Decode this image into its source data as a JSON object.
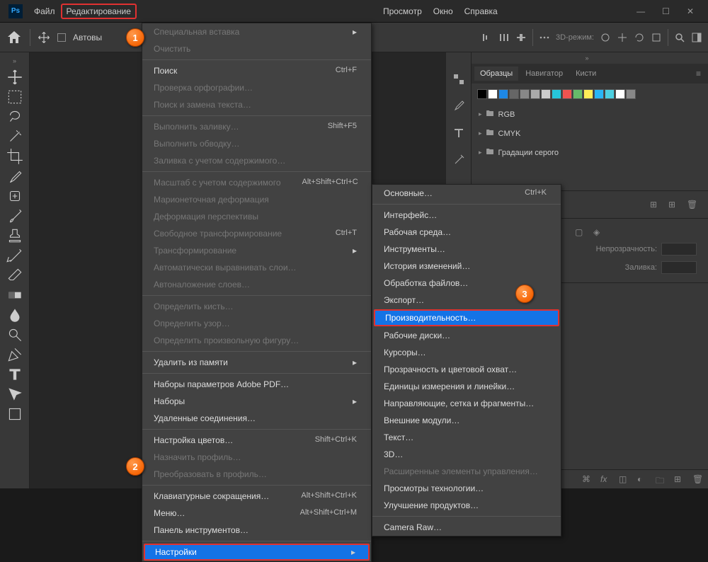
{
  "menubar": {
    "file": "Файл",
    "edit": "Редактирование",
    "view": "Просмотр",
    "window": "Окно",
    "help": "Справка"
  },
  "toolbar": {
    "autoselect": "Автовы",
    "mode3d": "3D-режим:"
  },
  "editMenu": {
    "pasteSpecial": "Специальная вставка",
    "clear": "Очистить",
    "search": "Поиск",
    "searchShortcut": "Ctrl+F",
    "spellCheck": "Проверка орфографии…",
    "findReplace": "Поиск и замена текста…",
    "fill": "Выполнить заливку…",
    "fillShortcut": "Shift+F5",
    "stroke": "Выполнить обводку…",
    "contentAwareFill": "Заливка с учетом содержимого…",
    "contentAwareScale": "Масштаб с учетом содержимого",
    "contentAwareScaleShortcut": "Alt+Shift+Ctrl+C",
    "puppetWarp": "Марионеточная деформация",
    "perspectiveWarp": "Деформация перспективы",
    "freeTransform": "Свободное трансформирование",
    "freeTransformShortcut": "Ctrl+T",
    "transform": "Трансформирование",
    "autoAlign": "Автоматически выравнивать слои…",
    "autoBlend": "Автоналожение слоев…",
    "defineBrush": "Определить кисть…",
    "definePattern": "Определить узор…",
    "defineShape": "Определить произвольную фигуру…",
    "purge": "Удалить из памяти",
    "pdfPresets": "Наборы параметров Adobe PDF…",
    "presets": "Наборы",
    "remoteConnections": "Удаленные соединения…",
    "colorSettings": "Настройка цветов…",
    "colorSettingsShortcut": "Shift+Ctrl+K",
    "assignProfile": "Назначить профиль…",
    "convertProfile": "Преобразовать в профиль…",
    "keyboardShortcuts": "Клавиатурные сокращения…",
    "keyboardShortcutsShortcut": "Alt+Shift+Ctrl+K",
    "menus": "Меню…",
    "menusShortcut": "Alt+Shift+Ctrl+M",
    "toolbar": "Панель инструментов…",
    "preferences": "Настройки"
  },
  "prefsMenu": {
    "general": "Основные…",
    "generalShortcut": "Ctrl+K",
    "interface": "Интерфейс…",
    "workspace": "Рабочая среда…",
    "tools": "Инструменты…",
    "historyLog": "История изменений…",
    "fileHandling": "Обработка файлов…",
    "export": "Экспорт…",
    "performance": "Производительность…",
    "scratchDisks": "Рабочие диски…",
    "cursors": "Курсоры…",
    "transparency": "Прозрачность и цветовой охват…",
    "units": "Единицы измерения и линейки…",
    "guides": "Направляющие, сетка и фрагменты…",
    "plugins": "Внешние модули…",
    "type": "Текст…",
    "threeD": "3D…",
    "enhancedControls": "Расширенные элементы управления…",
    "techPreviews": "Просмотры технологии…",
    "productImprovement": "Улучшение продуктов…",
    "cameraRaw": "Camera Raw…"
  },
  "panels": {
    "swatches": "Образцы",
    "navigator": "Навигатор",
    "brushes": "Кисти",
    "rgb": "RGB",
    "cmyk": "CMYK",
    "grayscale": "Градации серого",
    "opacity": "Непрозрачность:",
    "fill": "Заливка:"
  },
  "swatchColors": [
    "#000",
    "#fff",
    "#1e88e5",
    "#666",
    "#888",
    "#aaa",
    "#ccc",
    "#26c6da",
    "#ef5350",
    "#66bb6a",
    "#ffee58",
    "#29b6f6",
    "#4dd0e1",
    "#fff",
    "#888"
  ],
  "callouts": {
    "c1": "1",
    "c2": "2",
    "c3": "3"
  }
}
